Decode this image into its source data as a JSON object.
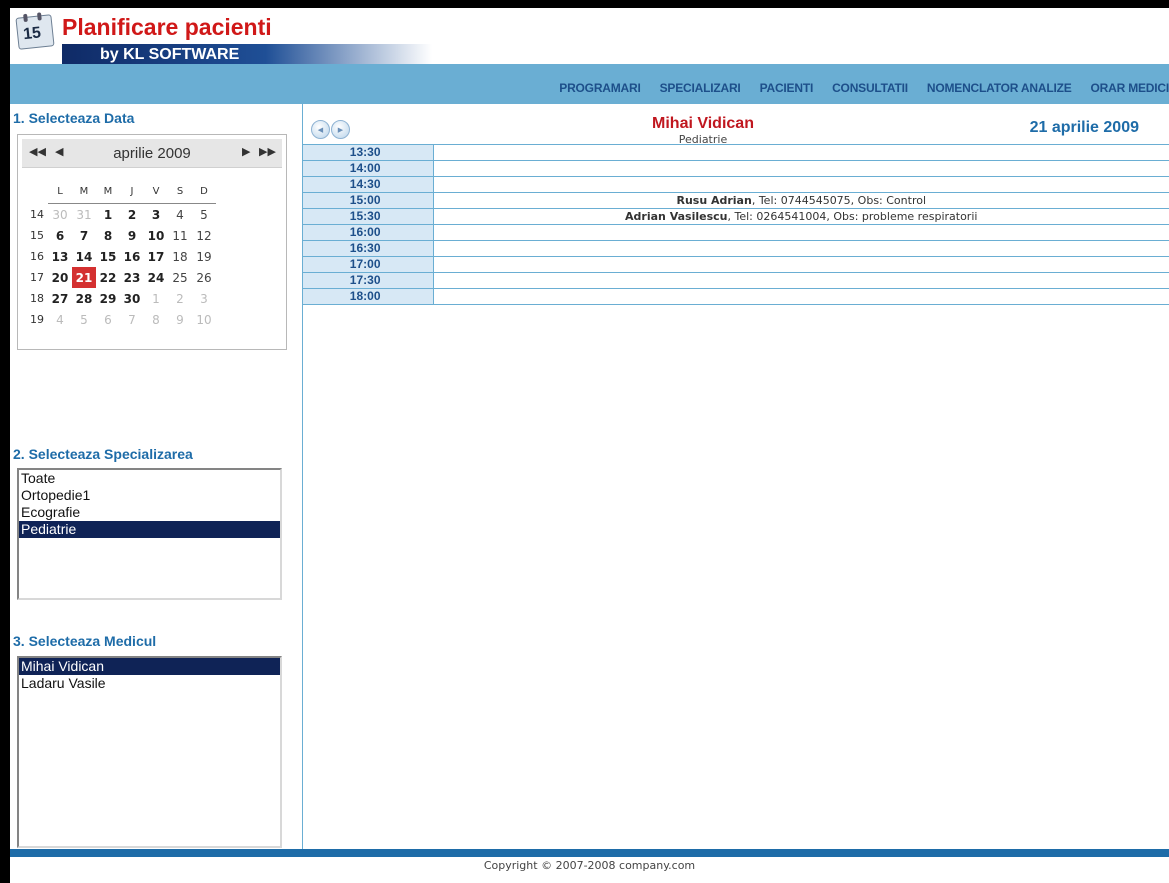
{
  "header": {
    "title": "Planificare pacienti",
    "subtitle": "by KL SOFTWARE",
    "logo_icon": "calendar-icon",
    "logo_number": "15"
  },
  "nav": {
    "items": [
      "PROGRAMARI",
      "SPECIALIZARI",
      "PACIENTI",
      "CONSULTATII",
      "NOMENCLATOR ANALIZE",
      "ORAR MEDICI"
    ]
  },
  "date_section": {
    "title": "1. Selecteaza Data",
    "month_label": "aprilie 2009",
    "prev_year_icon": "double-left-arrow-icon",
    "prev_month_icon": "left-arrow-icon",
    "next_month_icon": "right-arrow-icon",
    "next_year_icon": "double-right-arrow-icon",
    "weekdays": [
      "L",
      "M",
      "M",
      "J",
      "V",
      "S",
      "D"
    ],
    "weeks": [
      {
        "num": "14",
        "days": [
          {
            "d": "30",
            "other": true
          },
          {
            "d": "31",
            "other": true
          },
          {
            "d": "1"
          },
          {
            "d": "2"
          },
          {
            "d": "3"
          },
          {
            "d": "4",
            "wkend": true
          },
          {
            "d": "5",
            "wkend": true
          }
        ]
      },
      {
        "num": "15",
        "days": [
          {
            "d": "6"
          },
          {
            "d": "7"
          },
          {
            "d": "8"
          },
          {
            "d": "9"
          },
          {
            "d": "10"
          },
          {
            "d": "11",
            "wkend": true
          },
          {
            "d": "12",
            "wkend": true
          }
        ]
      },
      {
        "num": "16",
        "days": [
          {
            "d": "13"
          },
          {
            "d": "14"
          },
          {
            "d": "15"
          },
          {
            "d": "16"
          },
          {
            "d": "17"
          },
          {
            "d": "18",
            "wkend": true
          },
          {
            "d": "19",
            "wkend": true
          }
        ]
      },
      {
        "num": "17",
        "days": [
          {
            "d": "20"
          },
          {
            "d": "21",
            "selected": true
          },
          {
            "d": "22"
          },
          {
            "d": "23"
          },
          {
            "d": "24"
          },
          {
            "d": "25",
            "wkend": true
          },
          {
            "d": "26",
            "wkend": true
          }
        ]
      },
      {
        "num": "18",
        "days": [
          {
            "d": "27"
          },
          {
            "d": "28"
          },
          {
            "d": "29"
          },
          {
            "d": "30"
          },
          {
            "d": "1",
            "other": true
          },
          {
            "d": "2",
            "other": true
          },
          {
            "d": "3",
            "other": true
          }
        ]
      },
      {
        "num": "19",
        "days": [
          {
            "d": "4",
            "other": true
          },
          {
            "d": "5",
            "other": true
          },
          {
            "d": "6",
            "other": true
          },
          {
            "d": "7",
            "other": true
          },
          {
            "d": "8",
            "other": true
          },
          {
            "d": "9",
            "other": true
          },
          {
            "d": "10",
            "other": true
          }
        ]
      }
    ],
    "selected_color": "#d43030"
  },
  "specialization_section": {
    "title": "2. Selecteaza Specializarea",
    "options": [
      "Toate",
      "Ortopedie1",
      "Ecografie",
      "Pediatrie"
    ],
    "selected": "Pediatrie"
  },
  "doctor_section": {
    "title": "3. Selecteaza Medicul",
    "options": [
      "Mihai Vidican",
      "Ladaru Vasile"
    ],
    "selected": "Mihai Vidican"
  },
  "main": {
    "doctor_name": "Mihai Vidican",
    "doctor_specialty": "Pediatrie",
    "date": "21 aprilie 2009",
    "prev_icon": "round-prev-icon",
    "next_icon": "round-next-icon",
    "slots": [
      {
        "time": "13:30",
        "name": "",
        "details": ""
      },
      {
        "time": "14:00",
        "name": "",
        "details": ""
      },
      {
        "time": "14:30",
        "name": "",
        "details": ""
      },
      {
        "time": "15:00",
        "name": "Rusu Adrian",
        "details": ", Tel: 0744545075, Obs: Control"
      },
      {
        "time": "15:30",
        "name": "Adrian Vasilescu",
        "details": ", Tel: 0264541004, Obs: probleme respiratorii"
      },
      {
        "time": "16:00",
        "name": "",
        "details": ""
      },
      {
        "time": "16:30",
        "name": "",
        "details": ""
      },
      {
        "time": "17:00",
        "name": "",
        "details": ""
      },
      {
        "time": "17:30",
        "name": "",
        "details": ""
      },
      {
        "time": "18:00",
        "name": "",
        "details": ""
      }
    ]
  },
  "footer": {
    "copyright": "Copyright © 2007-2008 company.com"
  },
  "colors": {
    "accent": "#6aaed3",
    "title_red": "#d01818",
    "section_blue": "#1e6ca8",
    "selected_navy": "#0f2356"
  }
}
